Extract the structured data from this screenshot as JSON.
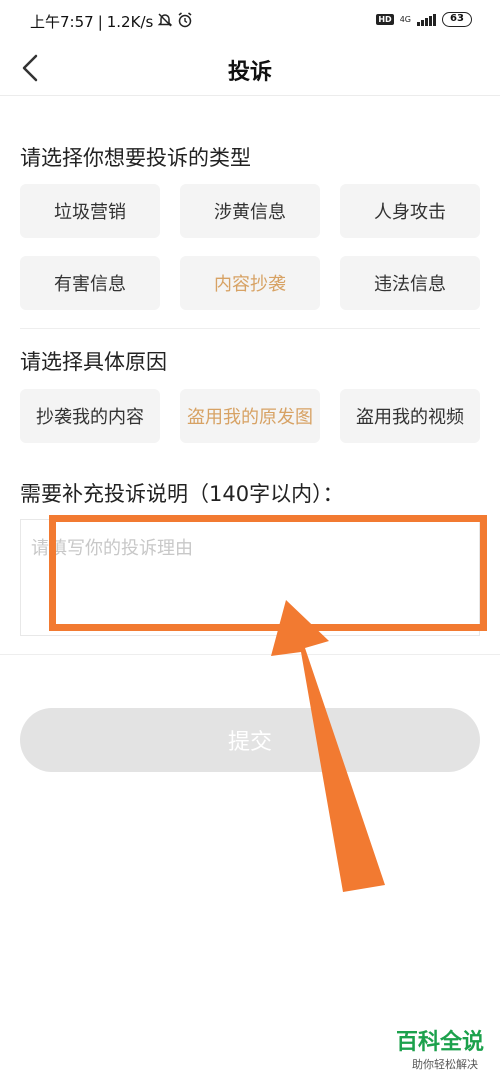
{
  "status_bar": {
    "time": "上午7:57",
    "separator": "|",
    "net_speed": "1.2K/s",
    "network_type": "4G",
    "hd_label": "HD",
    "battery": "63"
  },
  "nav": {
    "title": "投诉"
  },
  "type_section": {
    "title": "请选择你想要投诉的类型",
    "options": [
      {
        "label": "垃圾营销",
        "selected": false
      },
      {
        "label": "涉黄信息",
        "selected": false
      },
      {
        "label": "人身攻击",
        "selected": false
      },
      {
        "label": "有害信息",
        "selected": false
      },
      {
        "label": "内容抄袭",
        "selected": true
      },
      {
        "label": "违法信息",
        "selected": false
      }
    ]
  },
  "reason_section": {
    "title": "请选择具体原因",
    "options": [
      {
        "label": "抄袭我的内容",
        "selected": false
      },
      {
        "label": "盗用我的原发图",
        "selected": true
      },
      {
        "label": "盗用我的视频",
        "selected": false
      }
    ]
  },
  "description_section": {
    "title": "需要补充投诉说明（140字以内）：",
    "value": "",
    "placeholder": "请填写你的投诉理由"
  },
  "submit": {
    "label": "提交"
  },
  "watermark": {
    "title": "百科全说",
    "subtitle": "助你轻松解决"
  },
  "colors": {
    "accent_selected": "#d7a264",
    "annotation_orange": "#f27a31",
    "submit_disabled": "#e3e3e3",
    "watermark_green": "#1ca14c"
  }
}
